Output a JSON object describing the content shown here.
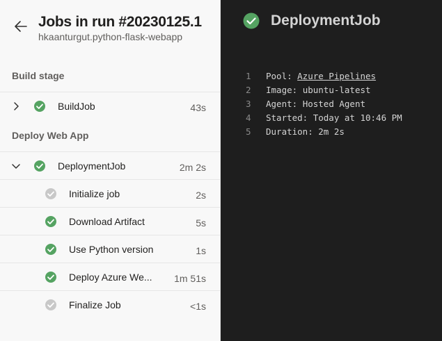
{
  "header": {
    "title": "Jobs in run #20230125.1",
    "subtitle": "hkaanturgut.python-flask-webapp"
  },
  "stages": [
    {
      "name": "Build stage",
      "jobs": [
        {
          "label": "BuildJob",
          "duration": "43s",
          "expanded": false,
          "status": "succeeded"
        }
      ]
    },
    {
      "name": "Deploy Web App",
      "jobs": [
        {
          "label": "DeploymentJob",
          "duration": "2m 2s",
          "expanded": true,
          "status": "succeeded",
          "steps": [
            {
              "label": "Initialize job",
              "duration": "2s",
              "status": "skipped"
            },
            {
              "label": "Download Artifact",
              "duration": "5s",
              "status": "succeeded"
            },
            {
              "label": "Use Python version",
              "duration": "1s",
              "status": "succeeded"
            },
            {
              "label": "Deploy Azure We...",
              "duration": "1m 51s",
              "status": "succeeded"
            },
            {
              "label": "Finalize Job",
              "duration": "<1s",
              "status": "skipped"
            }
          ]
        }
      ]
    }
  ],
  "detail": {
    "title": "DeploymentJob",
    "status": "succeeded",
    "log": [
      {
        "n": "1",
        "key": "Pool: ",
        "value": "Azure Pipelines",
        "link": true
      },
      {
        "n": "2",
        "key": "Image: ",
        "value": "ubuntu-latest",
        "link": false
      },
      {
        "n": "3",
        "key": "Agent: ",
        "value": "Hosted Agent",
        "link": false
      },
      {
        "n": "4",
        "key": "Started: ",
        "value": "Today at 10:46 PM",
        "link": false
      },
      {
        "n": "5",
        "key": "Duration: ",
        "value": "2m 2s",
        "link": false
      }
    ]
  },
  "colors": {
    "success": "#55a362",
    "skipped": "#c8c8c8",
    "log_bg": "#1e1e1e"
  },
  "icons": {
    "back": "arrow-left-icon",
    "chevron_collapsed": "chevron-right-icon",
    "chevron_expanded": "chevron-down-icon",
    "succeeded": "check-circle-icon",
    "skipped": "skipped-circle-icon"
  }
}
